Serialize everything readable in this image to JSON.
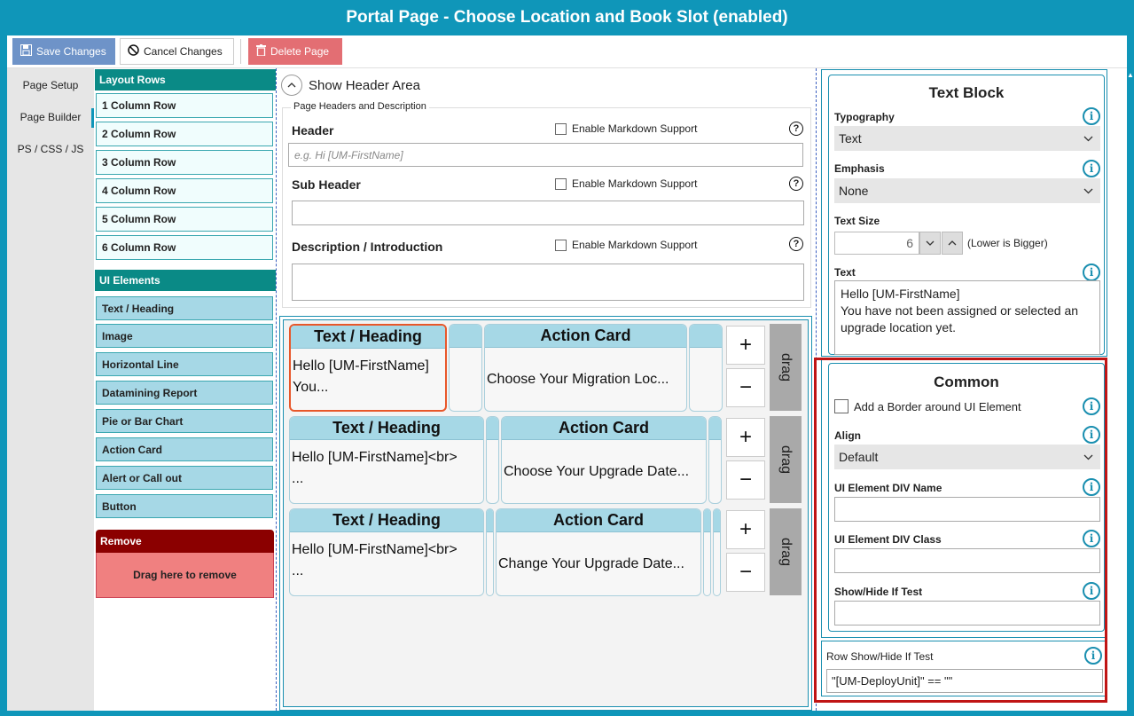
{
  "window": {
    "title": "Portal Page -  Choose Location and Book Slot (enabled)"
  },
  "toolbar": {
    "save_label": "Save Changes",
    "cancel_label": "Cancel Changes",
    "delete_label": "Delete Page"
  },
  "leftnav": {
    "items": [
      {
        "label": "Page Setup"
      },
      {
        "label": "Page Builder"
      },
      {
        "label": "PS / CSS / JS"
      }
    ]
  },
  "palette": {
    "layout_rows_title": "Layout Rows",
    "layout_rows": [
      "1 Column Row",
      "2 Column Row",
      "3 Column Row",
      "4 Column Row",
      "5 Column Row",
      "6 Column Row"
    ],
    "ui_elements_title": "UI Elements",
    "ui_elements": [
      "Text / Heading",
      "Image",
      "Horizontal Line",
      "Datamining Report",
      "Pie or Bar Chart",
      "Action Card",
      "Alert or Call out",
      "Button"
    ],
    "remove_title": "Remove",
    "remove_hint": "Drag here to remove"
  },
  "header_area": {
    "toggle_label": "Show Header Area",
    "legend": "Page Headers and Description",
    "markdown_label": "Enable Markdown Support",
    "header_label": "Header",
    "header_placeholder": "e.g. Hi [UM-FirstName]",
    "subheader_label": "Sub Header",
    "description_label": "Description / Introduction"
  },
  "canvas": {
    "rows": [
      {
        "cells": [
          {
            "title": "Text / Heading",
            "body": "Hello [UM-FirstName]\nYou...",
            "selected": true
          },
          {
            "title": "Action Card",
            "body": "Choose Your Migration Loc..."
          }
        ]
      },
      {
        "cells": [
          {
            "title": "Text / Heading",
            "body": "Hello [UM-FirstName]<br>\n..."
          },
          {
            "title": "Action Card",
            "body": "Choose Your Upgrade Date..."
          }
        ]
      },
      {
        "cells": [
          {
            "title": "Text / Heading",
            "body": "Hello [UM-FirstName]<br>\n..."
          },
          {
            "title": "Action Card",
            "body": "Change Your Upgrade Date..."
          }
        ]
      }
    ],
    "plus_label": "+",
    "minus_label": "−",
    "drag_label": "drag"
  },
  "text_block": {
    "title": "Text Block",
    "typography_label": "Typography",
    "typography_value": "Text",
    "emphasis_label": "Emphasis",
    "emphasis_value": "None",
    "text_size_label": "Text Size",
    "text_size_value": "6",
    "text_size_hint": "(Lower is Bigger)",
    "text_label": "Text",
    "text_value": "Hello [UM-FirstName]\nYou have not been assigned or selected an upgrade location yet."
  },
  "common": {
    "title": "Common",
    "border_label": "Add a Border around UI Element",
    "align_label": "Align",
    "align_value": "Default",
    "div_name_label": "UI Element DIV Name",
    "div_class_label": "UI Element DIV Class",
    "show_hide_label": "Show/Hide If Test"
  },
  "row_test": {
    "label": "Row Show/Hide If Test",
    "value": "\"[UM-DeployUnit]\" == \"\""
  },
  "colors": {
    "titlebar": "#0f96b9",
    "teal_header": "#0a8a86",
    "element_fill": "#a6d8e6",
    "remove_header": "#8b0000",
    "remove_body": "#f08080",
    "selection": "#e8572a",
    "highlight": "#c01515"
  }
}
